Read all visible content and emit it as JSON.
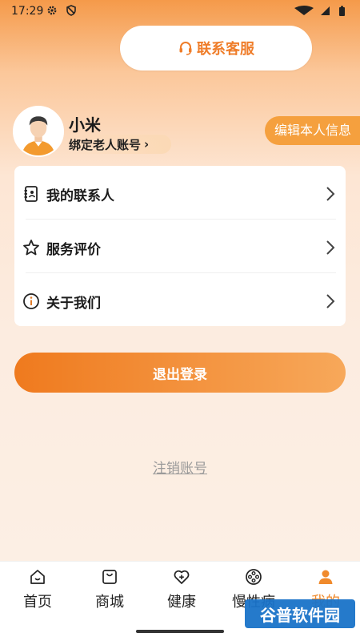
{
  "status_bar": {
    "time": "17:29"
  },
  "contact": {
    "label": "联系客服",
    "icon": "headset-icon"
  },
  "profile": {
    "name": "小米",
    "bind_label": "绑定老人账号",
    "edit_label": "编辑本人信息"
  },
  "menu": {
    "items": [
      {
        "label": "我的联系人",
        "icon": "contacts-book-icon"
      },
      {
        "label": "服务评价",
        "icon": "star-icon"
      },
      {
        "label": "关于我们",
        "icon": "info-icon"
      }
    ]
  },
  "logout_label": "退出登录",
  "cancel_account_label": "注销账号",
  "tabs": [
    {
      "label": "首页",
      "icon": "home-icon"
    },
    {
      "label": "商城",
      "icon": "shopping-bag-icon"
    },
    {
      "label": "健康",
      "icon": "heart-plus-icon"
    },
    {
      "label": "慢性病",
      "icon": "film-reel-icon"
    },
    {
      "label": "我的",
      "icon": "person-icon",
      "active": true
    }
  ],
  "watermark": "谷普软件园",
  "colors": {
    "accent": "#f08a2c",
    "edit_button": "#f5a03e",
    "watermark": "#1a73c9"
  }
}
